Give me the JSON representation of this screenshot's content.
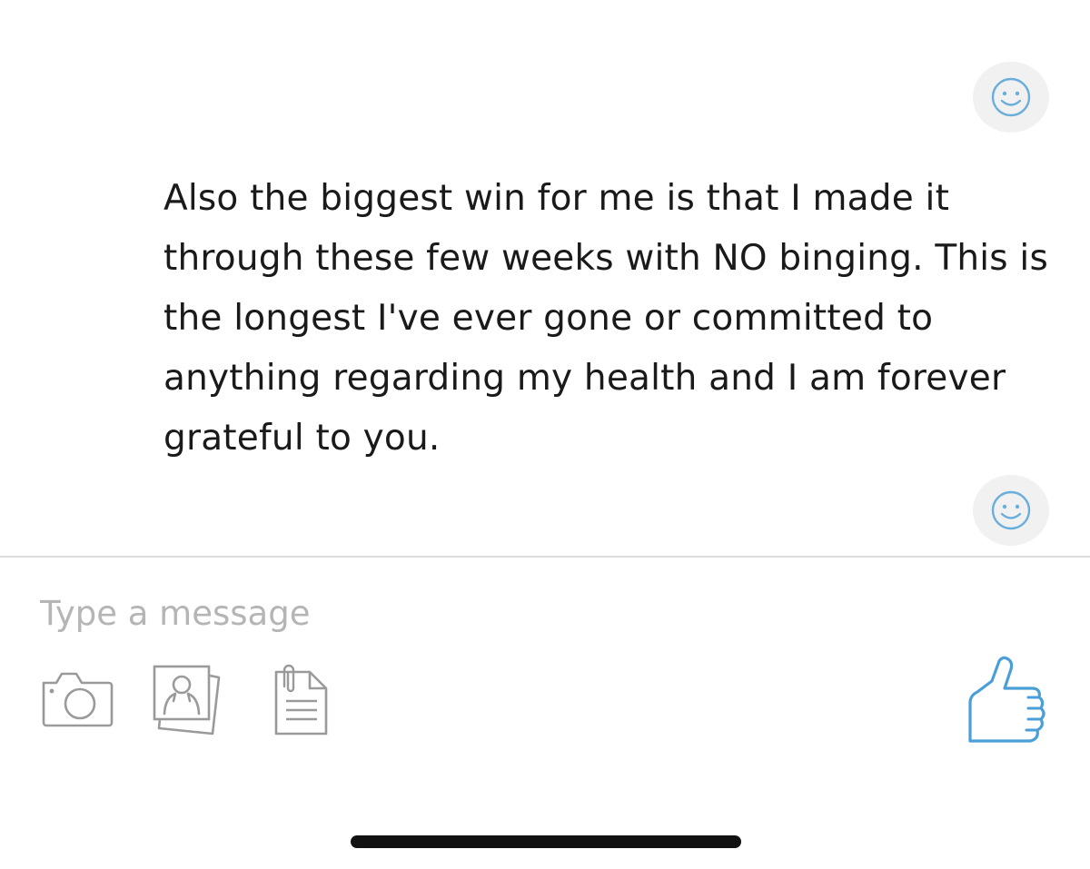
{
  "message": {
    "text": "Also the biggest win for me is that I made it through these few weeks with NO binging. This is the longest I've ever gone or committed to anything regarding my health and I am forever grateful to you."
  },
  "reactions": {
    "top_icon": "smiley-icon",
    "bottom_icon": "smiley-icon",
    "color": "#6aaedb"
  },
  "composer": {
    "placeholder": "Type a message",
    "tools": [
      "camera-icon",
      "photo-icon",
      "document-icon"
    ],
    "send_icon": "thumbs-up-icon",
    "send_color": "#4a9fd8"
  }
}
